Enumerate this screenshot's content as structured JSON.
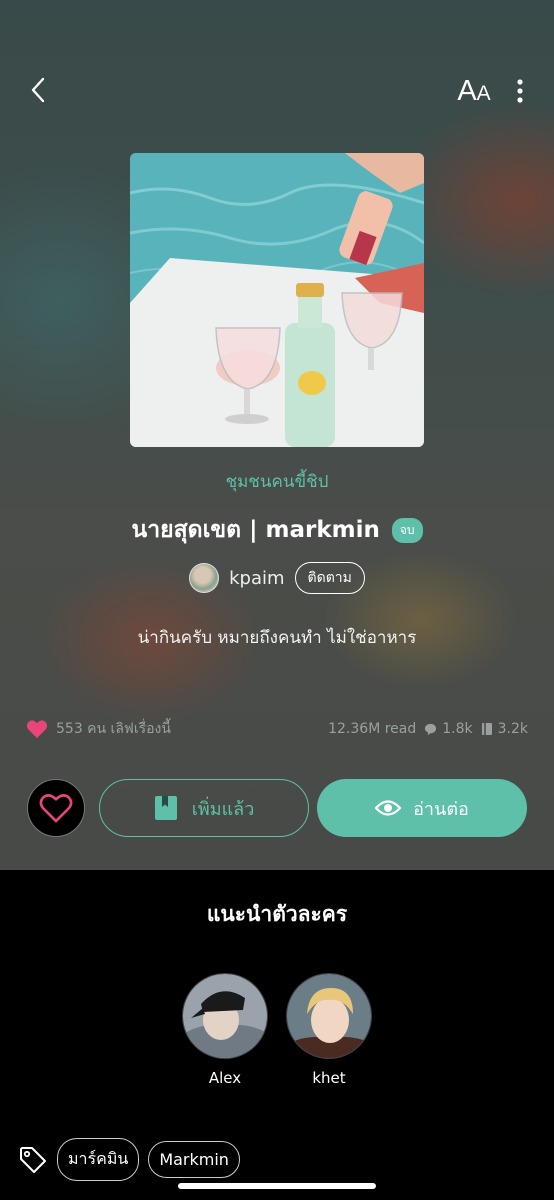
{
  "header": {
    "font_icon_big": "A",
    "font_icon_small": "A"
  },
  "story": {
    "category": "ชุมชนคนขี้ชิป",
    "title": "นายสุดเขต | markmin",
    "status_badge": "จบ",
    "author": "kpaim",
    "follow_label": "ติดตาม",
    "description": "น่ากินครับ หมายถึงคนทำ ไม่ใช่อาหาร"
  },
  "stats": {
    "likes_text": "553 คน เลิฟเรื่องนี้",
    "reads": "12.36M read",
    "comments": "1.8k",
    "chapters": "3.2k"
  },
  "actions": {
    "library_label": "เพิ่มแล้ว",
    "read_label": "อ่านต่อ"
  },
  "characters_section": {
    "title": "แนะนำตัวละคร",
    "characters": [
      {
        "name": "Alex"
      },
      {
        "name": "khet"
      }
    ]
  },
  "tags": [
    "มาร์คมิน",
    "Markmin"
  ],
  "colors": {
    "accent": "#5ec0a8",
    "heart": "#e8457a"
  }
}
